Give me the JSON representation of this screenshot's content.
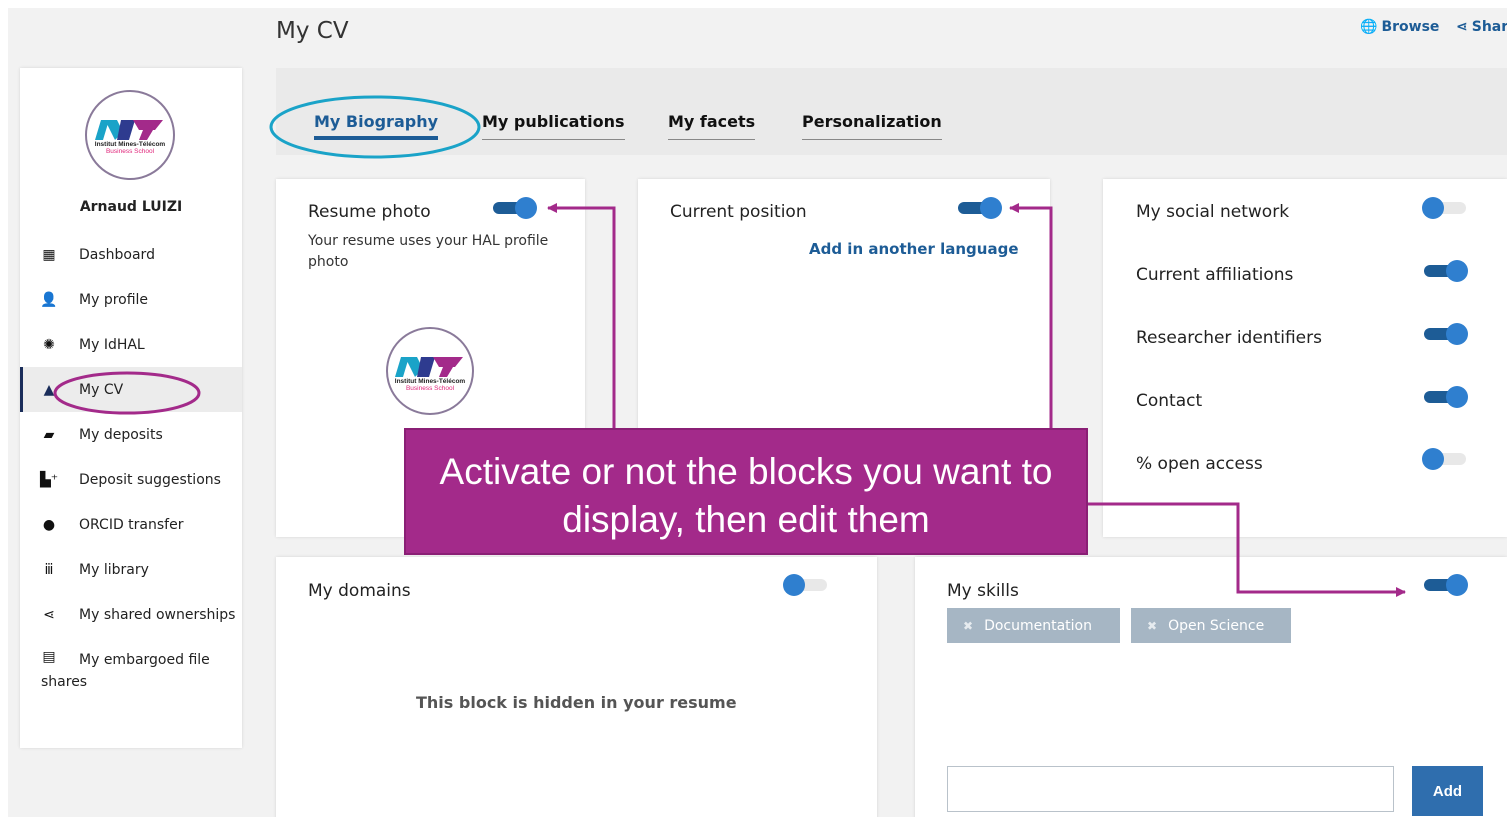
{
  "header": {
    "page_title": "My CV",
    "browse_label": "Browse",
    "share_label": "Shar"
  },
  "logo": {
    "line1": "Institut Mines-Télécom",
    "line2": "Business School"
  },
  "sidebar": {
    "user_name": "Arnaud LUIZI",
    "items": [
      {
        "label": "Dashboard",
        "icon": "dashboard-icon",
        "glyph": "▦"
      },
      {
        "label": "My profile",
        "icon": "person-icon",
        "glyph": "👤"
      },
      {
        "label": "My IdHAL",
        "icon": "idhal-icon",
        "glyph": "✺"
      },
      {
        "label": "My CV",
        "icon": "cv-icon",
        "glyph": "▲"
      },
      {
        "label": "My deposits",
        "icon": "folder-icon",
        "glyph": "▰"
      },
      {
        "label": "Deposit suggestions",
        "icon": "suggestion-icon",
        "glyph": "▙⁺"
      },
      {
        "label": "ORCID transfer",
        "icon": "orcid-icon",
        "glyph": "●"
      },
      {
        "label": "My library",
        "icon": "library-icon",
        "glyph": "ⅲ"
      },
      {
        "label": "My shared ownerships",
        "icon": "share-icon",
        "glyph": "⋖"
      },
      {
        "label": "My embargoed file shares",
        "icon": "file-icon",
        "glyph": "▤"
      }
    ]
  },
  "tabs": [
    {
      "label": "My Biography",
      "active": true
    },
    {
      "label": "My publications",
      "active": false
    },
    {
      "label": "My facets",
      "active": false
    },
    {
      "label": "Personalization",
      "active": false
    }
  ],
  "resume_photo": {
    "title": "Resume photo",
    "description": "Your resume uses your HAL profile photo",
    "enabled": true
  },
  "current_position": {
    "title": "Current position",
    "add_language_link": "Add in another language",
    "enabled": true
  },
  "social": {
    "rows": [
      {
        "label": "My social network",
        "enabled": false
      },
      {
        "label": "Current affiliations",
        "enabled": true
      },
      {
        "label": "Researcher identifiers",
        "enabled": true
      },
      {
        "label": "Contact",
        "enabled": true
      },
      {
        "label": "% open access",
        "enabled": false
      }
    ]
  },
  "domains": {
    "title": "My domains",
    "hidden_message": "This block is hidden in your resume",
    "enabled": false
  },
  "skills": {
    "title": "My skills",
    "enabled": true,
    "chips": [
      "Documentation",
      "Open Science"
    ],
    "input_value": "",
    "add_label": "Add"
  },
  "callout": {
    "text": "Activate or not the blocks you want to display, then edit them"
  },
  "colors": {
    "accent": "#1d5c96",
    "toggle_knob": "#2f7fcf",
    "callout": "#a32a8a",
    "annotation": "#1aa3c8",
    "chip": "#a6b6c4"
  }
}
